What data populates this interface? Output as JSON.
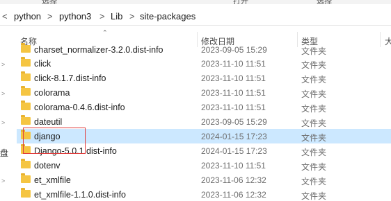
{
  "address": {
    "crumbs": [
      "python",
      "python3",
      "Lib",
      "site-packages"
    ],
    "separator": ">",
    "nav_left": "<"
  },
  "top_strip": {
    "labels": [
      "选择",
      "打开",
      "选择"
    ]
  },
  "columns": {
    "name": "名称",
    "date": "修改日期",
    "type": "类型",
    "size": "大"
  },
  "sidebar": {
    "chevron": ">",
    "partial_label": "盘"
  },
  "files": [
    {
      "name": "charset_normalizer-3.2.0.dist-info",
      "date": "2023-09-05 15:29",
      "type": "文件夹"
    },
    {
      "name": "click",
      "date": "2023-11-10 11:51",
      "type": "文件夹"
    },
    {
      "name": "click-8.1.7.dist-info",
      "date": "2023-11-10 11:51",
      "type": "文件夹"
    },
    {
      "name": "colorama",
      "date": "2023-11-10 11:51",
      "type": "文件夹"
    },
    {
      "name": "colorama-0.4.6.dist-info",
      "date": "2023-11-10 11:51",
      "type": "文件夹"
    },
    {
      "name": "dateutil",
      "date": "2023-09-05 15:29",
      "type": "文件夹"
    },
    {
      "name": "django",
      "date": "2024-01-15 17:23",
      "type": "文件夹",
      "selected": true
    },
    {
      "name": "Django-5.0.1.dist-info",
      "date": "2024-01-15 17:23",
      "type": "文件夹"
    },
    {
      "name": "dotenv",
      "date": "2023-11-10 11:51",
      "type": "文件夹"
    },
    {
      "name": "et_xmlfile",
      "date": "2023-11-06 12:32",
      "type": "文件夹"
    },
    {
      "name": "et_xmlfile-1.1.0.dist-info",
      "date": "2023-11-06 12:32",
      "type": "文件夹"
    }
  ],
  "colors": {
    "selected_row": "#cce8ff",
    "folder": "#f5c542",
    "highlight_box": "#e03a3a"
  }
}
